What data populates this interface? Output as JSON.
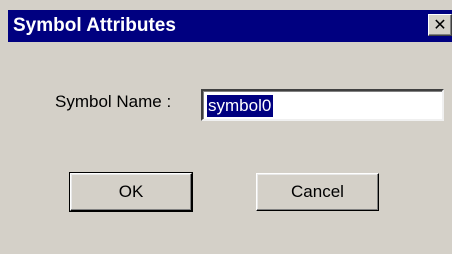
{
  "window": {
    "title": "Symbol Attributes",
    "close_glyph": "✕",
    "close_icon": "close-icon"
  },
  "form": {
    "symbol_name_label": "Symbol Name :",
    "symbol_name_value": "symbol0"
  },
  "buttons": {
    "ok_label": "OK",
    "cancel_label": "Cancel"
  },
  "colors": {
    "title_bar": "#000080",
    "dialog_face": "#d4d0c8",
    "selection": "#000080"
  }
}
